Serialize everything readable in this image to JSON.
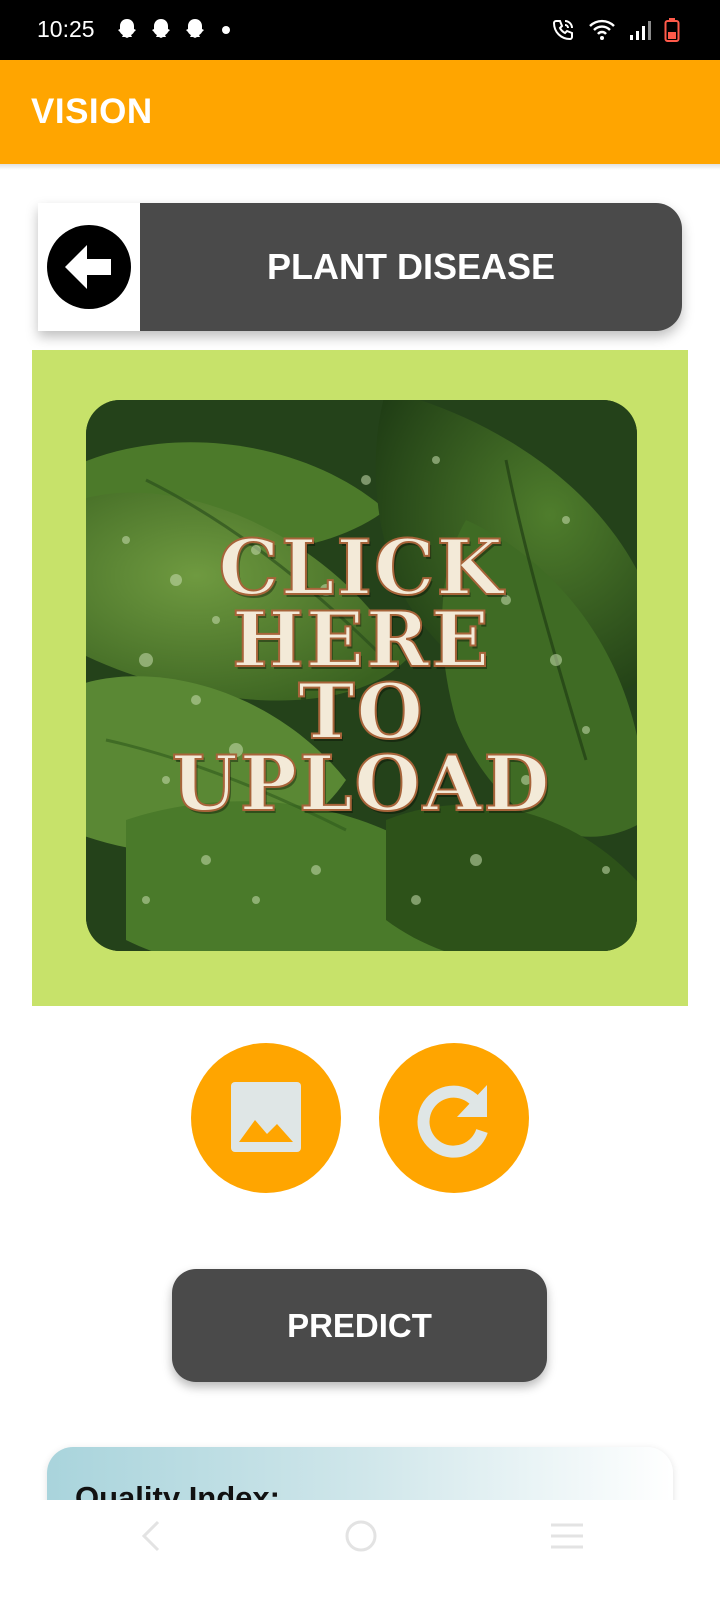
{
  "status_bar": {
    "time": "10:25",
    "left_icons": [
      "snapchat-icon",
      "snapchat-icon",
      "snapchat-icon",
      "dot-icon"
    ],
    "right_icons": [
      "wifi-calling-icon",
      "wifi-icon",
      "signal-icon",
      "battery-icon"
    ]
  },
  "app_bar": {
    "title": "VISION",
    "color": "#FFA500"
  },
  "header": {
    "back_icon": "arrow-left-icon",
    "title": "PLANT DISEASE",
    "color": "#4A4A4A"
  },
  "upload": {
    "panel_color": "#C7E26A",
    "lines": [
      "CLICK",
      "HERE",
      "TO",
      "UPLOAD"
    ]
  },
  "actions": {
    "gallery_icon": "image-icon",
    "refresh_icon": "refresh-icon",
    "color": "#FFA500"
  },
  "predict": {
    "label": "PREDICT"
  },
  "quality": {
    "label": "Quality Index:"
  },
  "nav_bar": {
    "icons": [
      "back-nav-icon",
      "home-nav-icon",
      "recents-nav-icon"
    ]
  }
}
